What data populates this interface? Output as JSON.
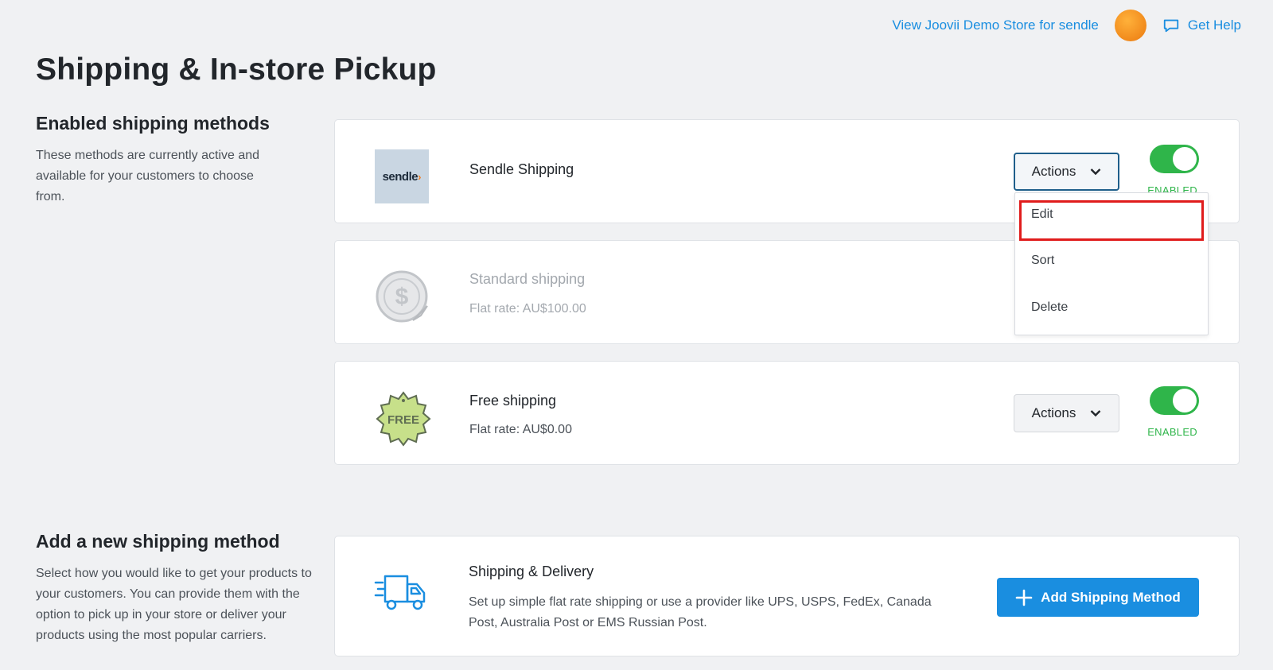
{
  "header": {
    "store_link": "View Joovii Demo Store for sendle",
    "help_label": "Get Help"
  },
  "page_title": "Shipping & In-store Pickup",
  "enabled_section": {
    "title": "Enabled shipping methods",
    "description": "These methods are currently active and available for your customers to choose from."
  },
  "methods": [
    {
      "name": "Sendle Shipping",
      "subtitle": "",
      "logo_text": "sendle",
      "actions_label": "Actions",
      "status": "ENABLED",
      "enabled": true
    },
    {
      "name": "Standard shipping",
      "subtitle": "Flat rate: AU$100.00",
      "logo_icon": "dollar-sticker-icon",
      "enabled": false
    },
    {
      "name": "Free shipping",
      "subtitle": "Flat rate: AU$0.00",
      "logo_text": "FREE",
      "actions_label": "Actions",
      "status": "ENABLED",
      "enabled": true
    }
  ],
  "actions_menu": {
    "items": [
      "Edit",
      "Sort",
      "Delete"
    ],
    "highlighted": "Edit"
  },
  "add_section": {
    "title": "Add a new shipping method",
    "description": "Select how you would like to get your products to your customers. You can provide them with the option to pick up in your store or deliver your products using the most popular carriers.",
    "card_title": "Shipping & Delivery",
    "card_description": "Set up simple flat rate shipping or use a provider like UPS, USPS, FedEx, Canada Post, Australia Post or EMS Russian Post.",
    "button_label": "Add Shipping Method"
  },
  "colors": {
    "accent_blue": "#1a8ee0",
    "enabled_green": "#2fb54a",
    "highlight_red": "#e01c1c"
  }
}
